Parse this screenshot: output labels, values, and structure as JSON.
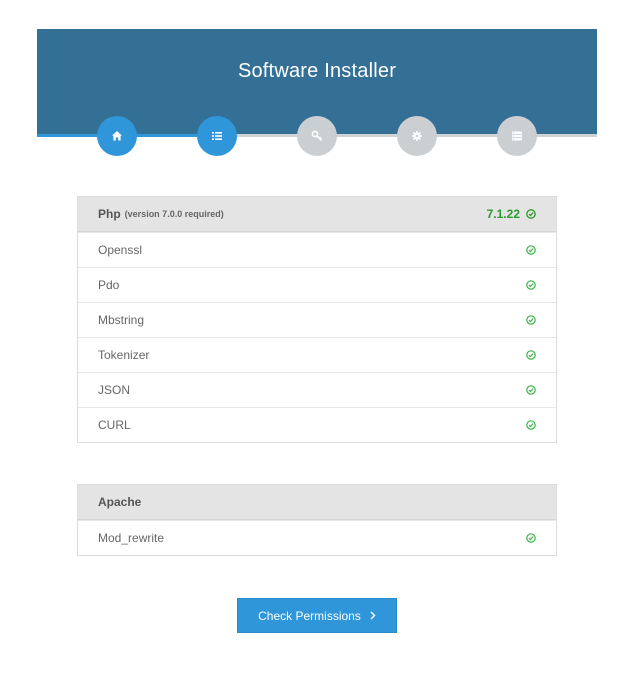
{
  "header": {
    "title": "Software Installer"
  },
  "steps": [
    {
      "icon": "home-icon",
      "state": "active"
    },
    {
      "icon": "list-icon",
      "state": "active"
    },
    {
      "icon": "key-icon",
      "state": "inactive"
    },
    {
      "icon": "gear-icon",
      "state": "inactive"
    },
    {
      "icon": "server-icon",
      "state": "inactive"
    }
  ],
  "php": {
    "title": "Php",
    "note": "(version 7.0.0 required)",
    "version": "7.1.22",
    "extensions": [
      {
        "label": "Openssl",
        "status": "ok"
      },
      {
        "label": "Pdo",
        "status": "ok"
      },
      {
        "label": "Mbstring",
        "status": "ok"
      },
      {
        "label": "Tokenizer",
        "status": "ok"
      },
      {
        "label": "JSON",
        "status": "ok"
      },
      {
        "label": "CURL",
        "status": "ok"
      }
    ]
  },
  "apache": {
    "title": "Apache",
    "modules": [
      {
        "label": "Mod_rewrite",
        "status": "ok"
      }
    ]
  },
  "button": {
    "label": "Check Permissions"
  },
  "colors": {
    "header": "#346f96",
    "accent": "#2f96d9",
    "inactive_step": "#cbcfd2",
    "success": "#2a9a2a"
  }
}
